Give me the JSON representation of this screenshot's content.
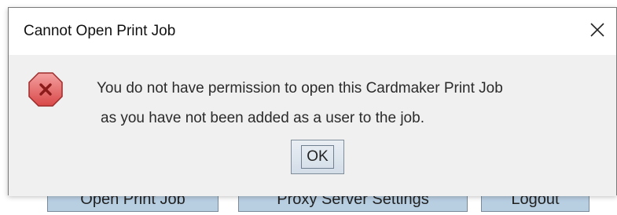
{
  "background": {
    "buttons": [
      {
        "label": "Open Print Job"
      },
      {
        "label": "Proxy Server Settings"
      },
      {
        "label": "Logout"
      }
    ]
  },
  "dialog": {
    "title": "Cannot Open Print Job",
    "close_icon": "close-icon",
    "error_icon": "error-icon",
    "message_line1": "You do not have permission to open this Cardmaker Print Job",
    "message_line2": "as you have not been added as a user to the job.",
    "ok_label": "OK"
  },
  "colors": {
    "error_red": "#e8565a",
    "error_dark": "#b22a2a",
    "button_bg": "#b8cfe2"
  }
}
